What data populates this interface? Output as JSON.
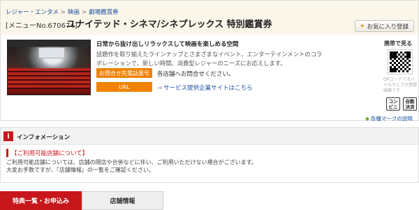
{
  "breadcrumb": {
    "items": [
      "レジャー・エンタメ",
      "映画",
      "劇場鑑賞券"
    ],
    "separator": ">"
  },
  "header": {
    "menu_number": "[メニューNo.670674]",
    "title": "ユナイテッド・シネマ/シネプレックス 特別鑑賞券",
    "favorite_label": "お気に入り登録",
    "favorite_prefix": "+"
  },
  "detail": {
    "lead": "日常から抜け出しリラックスして映画を楽しめる空間",
    "description": "話題作を取り揃えたラインナップとさまざまなイベント、エンターテインメントのコラボレーションで、新しい時間、消費型レジャーのニーズにお応えします。",
    "phone_label": "お問合せ先電話番号",
    "phone_text": "各店舗へお問合せください。",
    "url_label": "URL",
    "url_link": "サービス提供企業サイトはこちら"
  },
  "side": {
    "mobile_label": "携帯で見る",
    "qr_note": "QRコードでモバイルウェブの登録画面です",
    "icons": [
      {
        "name": "conveni-icon",
        "line1": "コン",
        "line2": "ビニ"
      },
      {
        "name": "auto-settle-icon",
        "line1": "自動",
        "line2": "決済"
      }
    ],
    "mark_link": "各種マークの説明"
  },
  "info": {
    "icon_glyph": "i",
    "title": "インフォメーション",
    "notice_heading": "【ご利用可能店舗について】",
    "notice_line1": "ご利用可能店舗については、店舗の閉店や合併などに伴い、ご利用いただけない場合がございます。",
    "notice_line2": "大変お手数ですが、『店舗情報』の一覧をご確認ください。"
  },
  "tabs": [
    {
      "label": "特典一覧・お申込み",
      "active": true
    },
    {
      "label": "店舗情報",
      "active": false
    }
  ],
  "colors": {
    "accent_red": "#c8161d",
    "accent_orange": "#f08200",
    "link_blue": "#1a4fa0",
    "header_bg": "#fbf6ea"
  }
}
